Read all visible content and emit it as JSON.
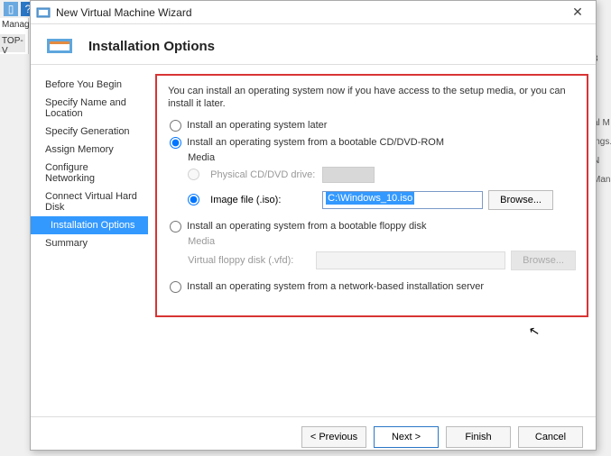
{
  "background": {
    "left1": "Manag",
    "left2": "TOP-V",
    "right": [
      "3",
      "al M",
      "ings.",
      "N",
      "Mana"
    ]
  },
  "dialog": {
    "title": "New Virtual Machine Wizard",
    "header": "Installation Options",
    "steps": [
      "Before You Begin",
      "Specify Name and Location",
      "Specify Generation",
      "Assign Memory",
      "Configure Networking",
      "Connect Virtual Hard Disk",
      "Installation Options",
      "Summary"
    ],
    "active_step": 6,
    "intro": "You can install an operating system now if you have access to the setup media, or you can install it later.",
    "options": {
      "later": "Install an operating system later",
      "cddvd": "Install an operating system from a bootable CD/DVD-ROM",
      "media_label": "Media",
      "physical_drive": "Physical CD/DVD drive:",
      "image_file": "Image file (.iso):",
      "iso_value": "C:\\Windows_10.iso",
      "browse": "Browse...",
      "floppy": "Install an operating system from a bootable floppy disk",
      "floppy_media": "Media",
      "floppy_label": "Virtual floppy disk (.vfd):",
      "network": "Install an operating system from a network-based installation server"
    },
    "buttons": {
      "previous": "< Previous",
      "next": "Next >",
      "finish": "Finish",
      "cancel": "Cancel"
    }
  }
}
